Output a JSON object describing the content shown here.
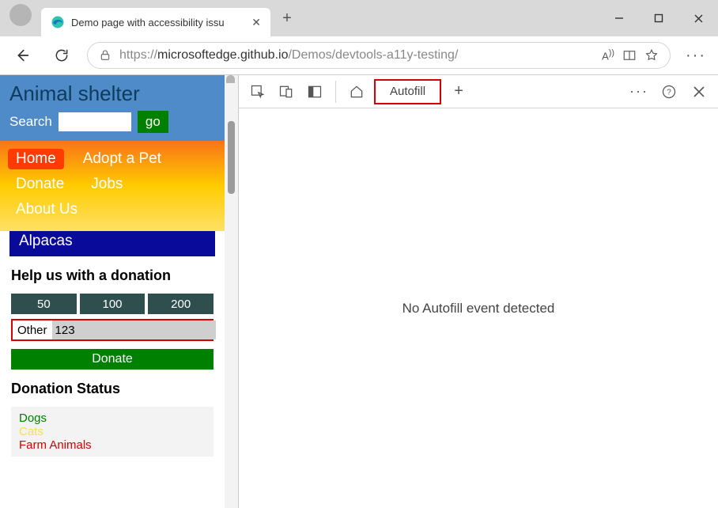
{
  "browser": {
    "tab_title": "Demo page with accessibility issu",
    "url_prefix": "https://",
    "url_host": "microsoftedge.github.io",
    "url_path": "/Demos/devtools-a11y-testing/"
  },
  "page": {
    "site_title": "Animal shelter",
    "search_label": "Search",
    "search_button": "go",
    "nav": {
      "home": "Home",
      "adopt": "Adopt a Pet",
      "donate": "Donate",
      "jobs": "Jobs",
      "about": "About Us"
    },
    "cut_heading": "Alpacas",
    "donation_heading": "Help us with a donation",
    "amounts": [
      "50",
      "100",
      "200"
    ],
    "other_label": "Other",
    "other_value": "123",
    "donate_button": "Donate",
    "status_heading": "Donation Status",
    "status_items": {
      "dogs": "Dogs",
      "cats": "Cats",
      "farm": "Farm Animals"
    }
  },
  "devtools": {
    "active_tab": "Autofill",
    "body_text": "No Autofill event detected"
  }
}
